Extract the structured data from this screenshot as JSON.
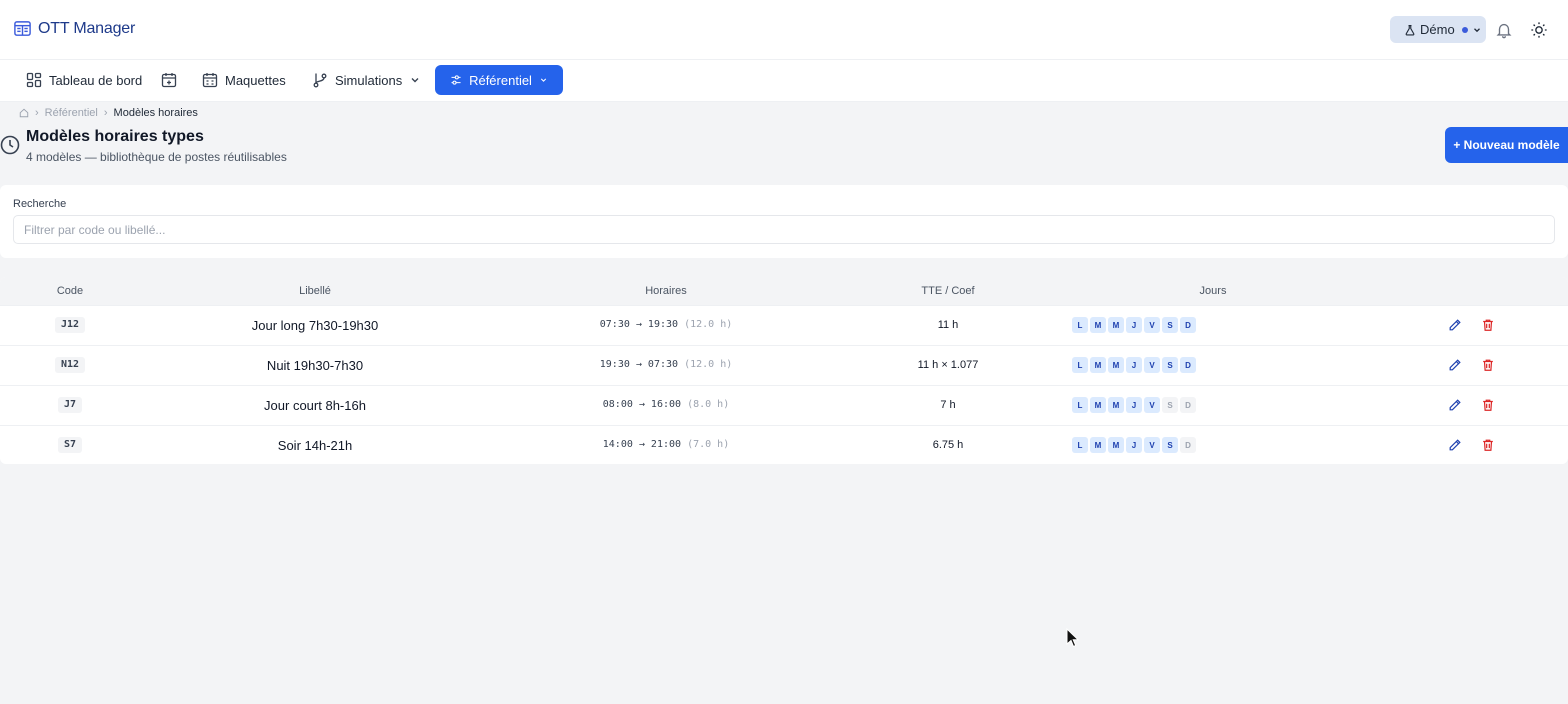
{
  "app": {
    "name": "OTT Manager"
  },
  "header": {
    "mode_label": "Démo"
  },
  "nav": {
    "dashboard": "Tableau de bord",
    "maquettes": "Maquettes",
    "simulations": "Simulations",
    "referentiel": "Référentiel"
  },
  "breadcrumb": {
    "level1": "Référentiel",
    "current": "Modèles horaires"
  },
  "page": {
    "title": "Modèles horaires types",
    "subtitle": "4 modèles — bibliothèque de postes réutilisables",
    "new_button": "+ Nouveau modèle"
  },
  "search": {
    "label": "Recherche",
    "placeholder": "Filtrer par code ou libellé...",
    "value": ""
  },
  "table": {
    "columns": [
      "Code",
      "Libellé",
      "Horaires",
      "TTE / Coef",
      "Jours"
    ],
    "rows": [
      {
        "code": "J12",
        "libelle": "Jour long 7h30-19h30",
        "horaires": "07:30 → 19:30",
        "duree": "(12.0 h)",
        "tte": "11 h",
        "days": [
          true,
          true,
          true,
          true,
          true,
          true,
          true
        ]
      },
      {
        "code": "N12",
        "libelle": "Nuit 19h30-7h30",
        "horaires": "19:30 → 07:30",
        "duree": "(12.0 h)",
        "tte": "11 h × 1.077",
        "days": [
          true,
          true,
          true,
          true,
          true,
          true,
          true
        ]
      },
      {
        "code": "J7",
        "libelle": "Jour court 8h-16h",
        "horaires": "08:00 → 16:00",
        "duree": "(8.0 h)",
        "tte": "7 h",
        "days": [
          true,
          true,
          true,
          true,
          true,
          false,
          false
        ]
      },
      {
        "code": "S7",
        "libelle": "Soir 14h-21h",
        "horaires": "14:00 → 21:00",
        "duree": "(7.0 h)",
        "tte": "6.75 h",
        "days": [
          true,
          true,
          true,
          true,
          true,
          true,
          false
        ]
      }
    ],
    "day_letters": [
      "L",
      "M",
      "M",
      "J",
      "V",
      "S",
      "D"
    ]
  },
  "colors": {
    "accent": "#2563eb",
    "danger": "#dc2626",
    "brand": "#1e3a8a"
  },
  "icons": [
    "app-logo-icon",
    "flask-icon",
    "bell-icon",
    "sun-icon",
    "dashboard-icon",
    "calendar-plus-icon",
    "calendar-icon",
    "branch-icon",
    "sliders-icon",
    "home-icon",
    "clock-icon",
    "pencil-icon",
    "trash-icon"
  ]
}
